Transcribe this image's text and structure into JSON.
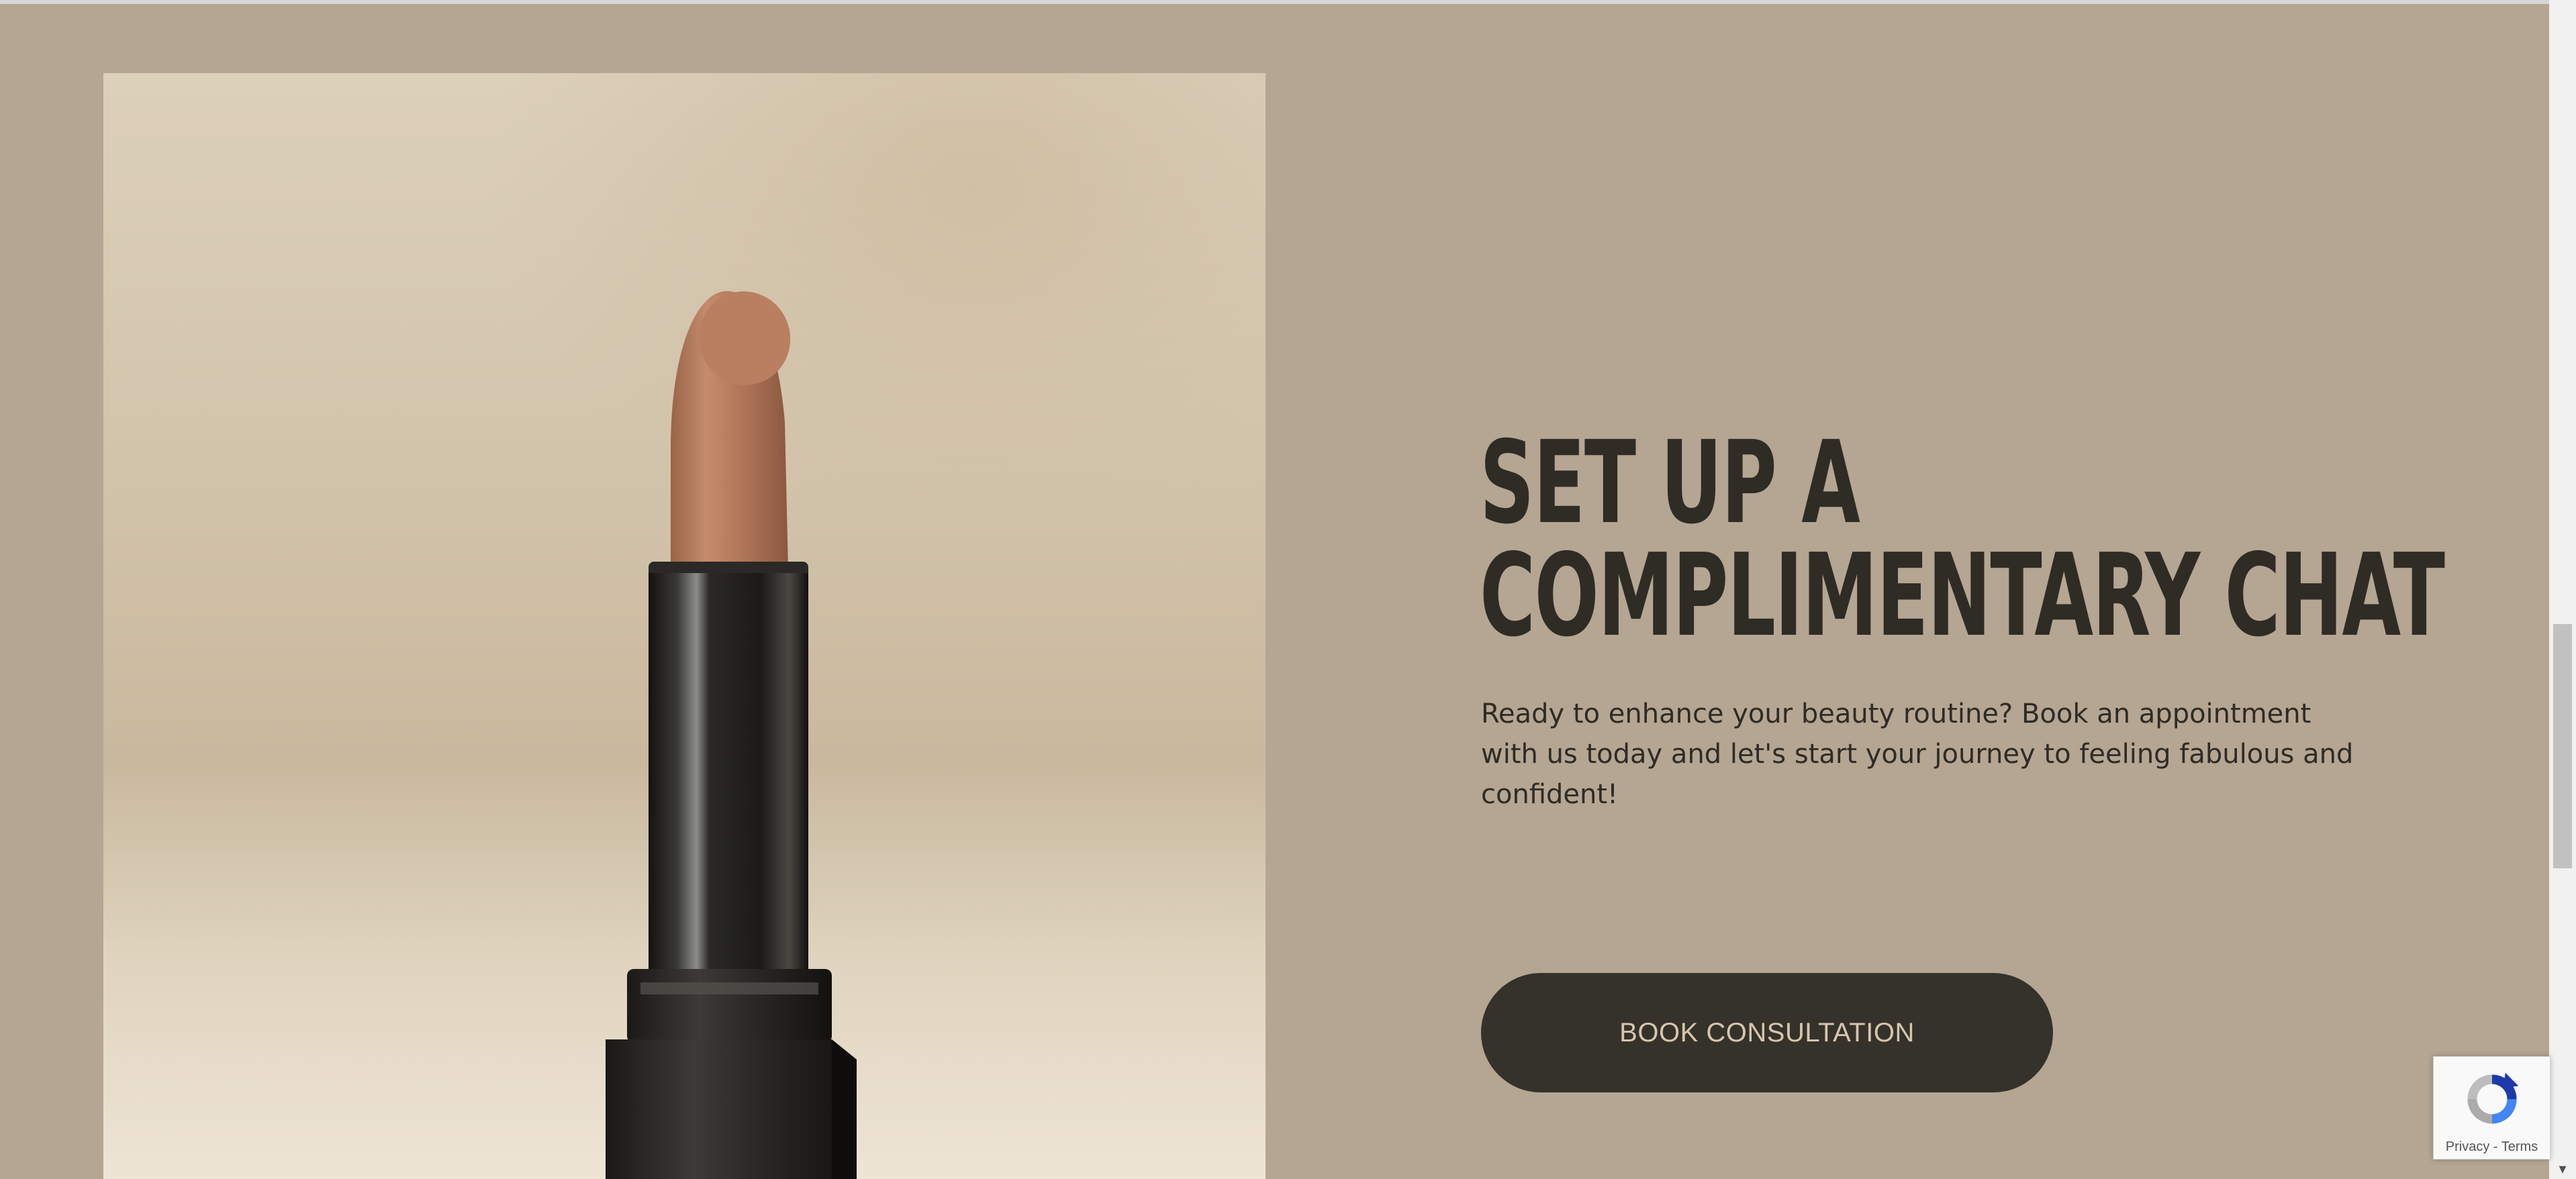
{
  "hero": {
    "heading_line1": "SET UP A",
    "heading_line2": "COMPLIMENTARY CHAT",
    "description": "Ready to enhance your beauty routine? Book an appointment with us today and let's start your journey to feeling fabulous and confident!",
    "cta_label": "BOOK CONSULTATION"
  },
  "recaptcha": {
    "privacy_label": "Privacy",
    "separator": " - ",
    "terms_label": "Terms"
  },
  "icons": {
    "scroll_down": "chevron-down-icon",
    "recaptcha": "recaptcha-icon"
  },
  "colors": {
    "background": "#b4a692",
    "heading": "#2f2b25",
    "button_bg": "#35322b",
    "button_text": "#d8c6ab"
  }
}
